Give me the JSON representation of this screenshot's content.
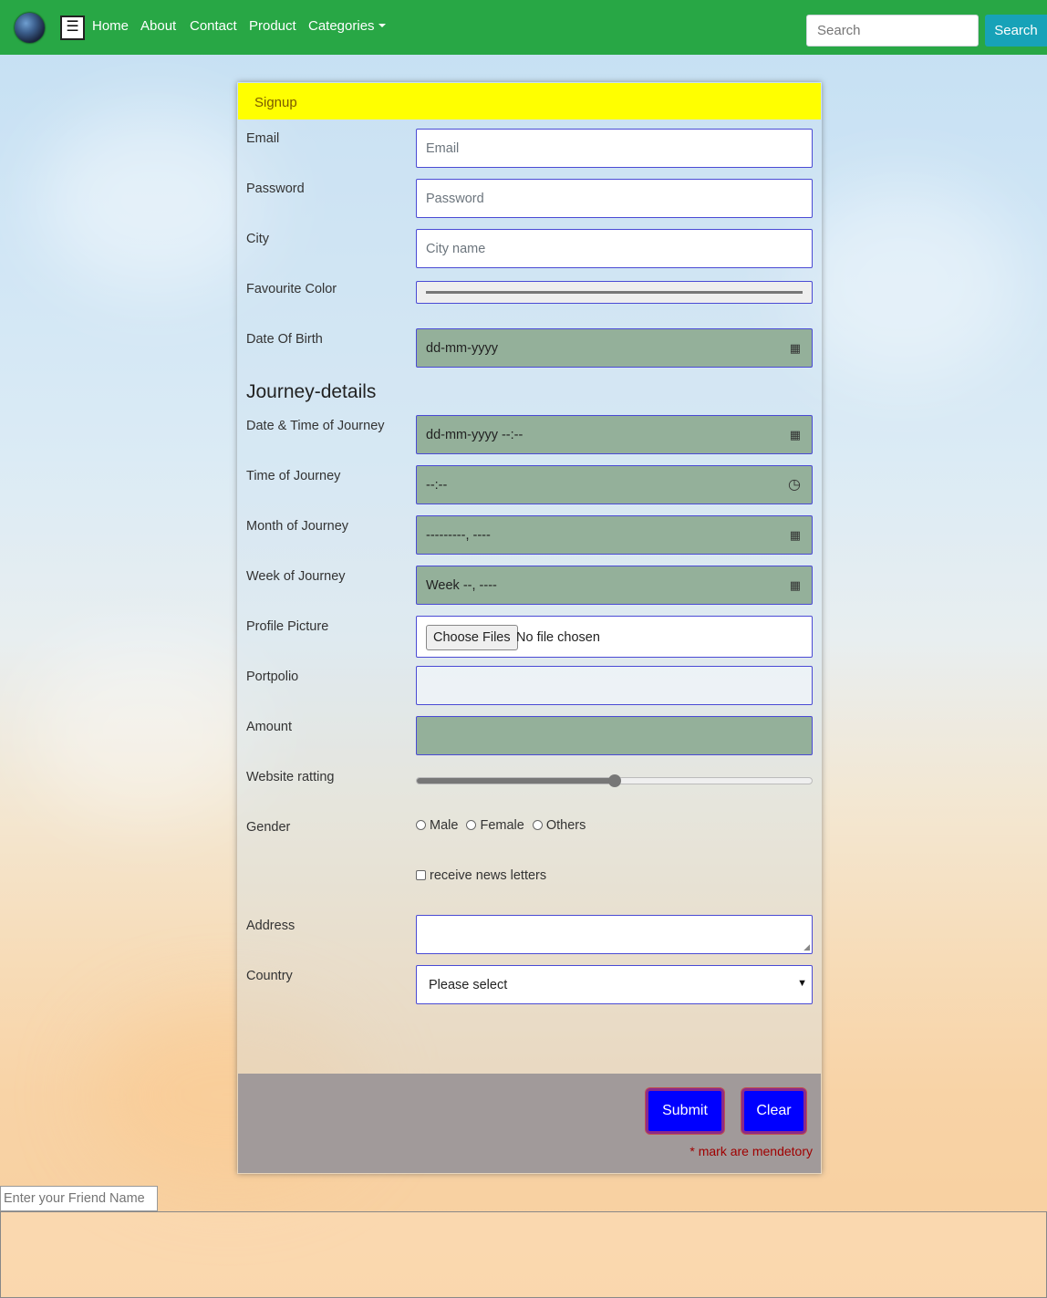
{
  "navbar": {
    "logo_icon": "globe-icon",
    "menu_icon": "hamburger-icon",
    "menu_glyph": "☰",
    "links": [
      "Home",
      "About",
      "Contact",
      "Product"
    ],
    "dropdown_label": "Categories",
    "search_placeholder": "Search",
    "search_button": "Search",
    "color": "#28a745"
  },
  "signup": {
    "header": "Signup",
    "header_color": "#ffff00",
    "fields": {
      "email": {
        "label": "Email",
        "placeholder": "Email"
      },
      "password": {
        "label": "Password",
        "placeholder": "Password"
      },
      "city": {
        "label": "City",
        "placeholder": "City name"
      },
      "favourite_color": {
        "label": "Favourite Color"
      },
      "dob": {
        "label": "Date Of Birth",
        "value": "dd-mm-yyyy"
      }
    },
    "journey_title": "Journey-details",
    "journey": {
      "datetime": {
        "label": "Date & Time of Journey",
        "value": "dd-mm-yyyy --:--"
      },
      "time": {
        "label": "Time of Journey",
        "value": "--:--"
      },
      "month": {
        "label": "Month of Journey",
        "value": "---------, ----"
      },
      "week": {
        "label": "Week of Journey",
        "value": "Week --, ----"
      }
    },
    "profile_picture": {
      "label": "Profile Picture",
      "button": "Choose Files",
      "status": "No file chosen"
    },
    "portfolio": {
      "label": "Portpolio"
    },
    "amount": {
      "label": "Amount"
    },
    "rating": {
      "label": "Website ratting",
      "value_fraction": 0.5
    },
    "gender": {
      "label": "Gender",
      "options": [
        "Male",
        "Female",
        "Others"
      ]
    },
    "newsletter": {
      "label": "receive news letters"
    },
    "address": {
      "label": "Address"
    },
    "country": {
      "label": "Country",
      "selected": "Please select"
    },
    "submit": "Submit",
    "clear": "Clear",
    "note": "* mark are mendetory"
  },
  "friend": {
    "placeholder": "Enter your Friend Name"
  }
}
